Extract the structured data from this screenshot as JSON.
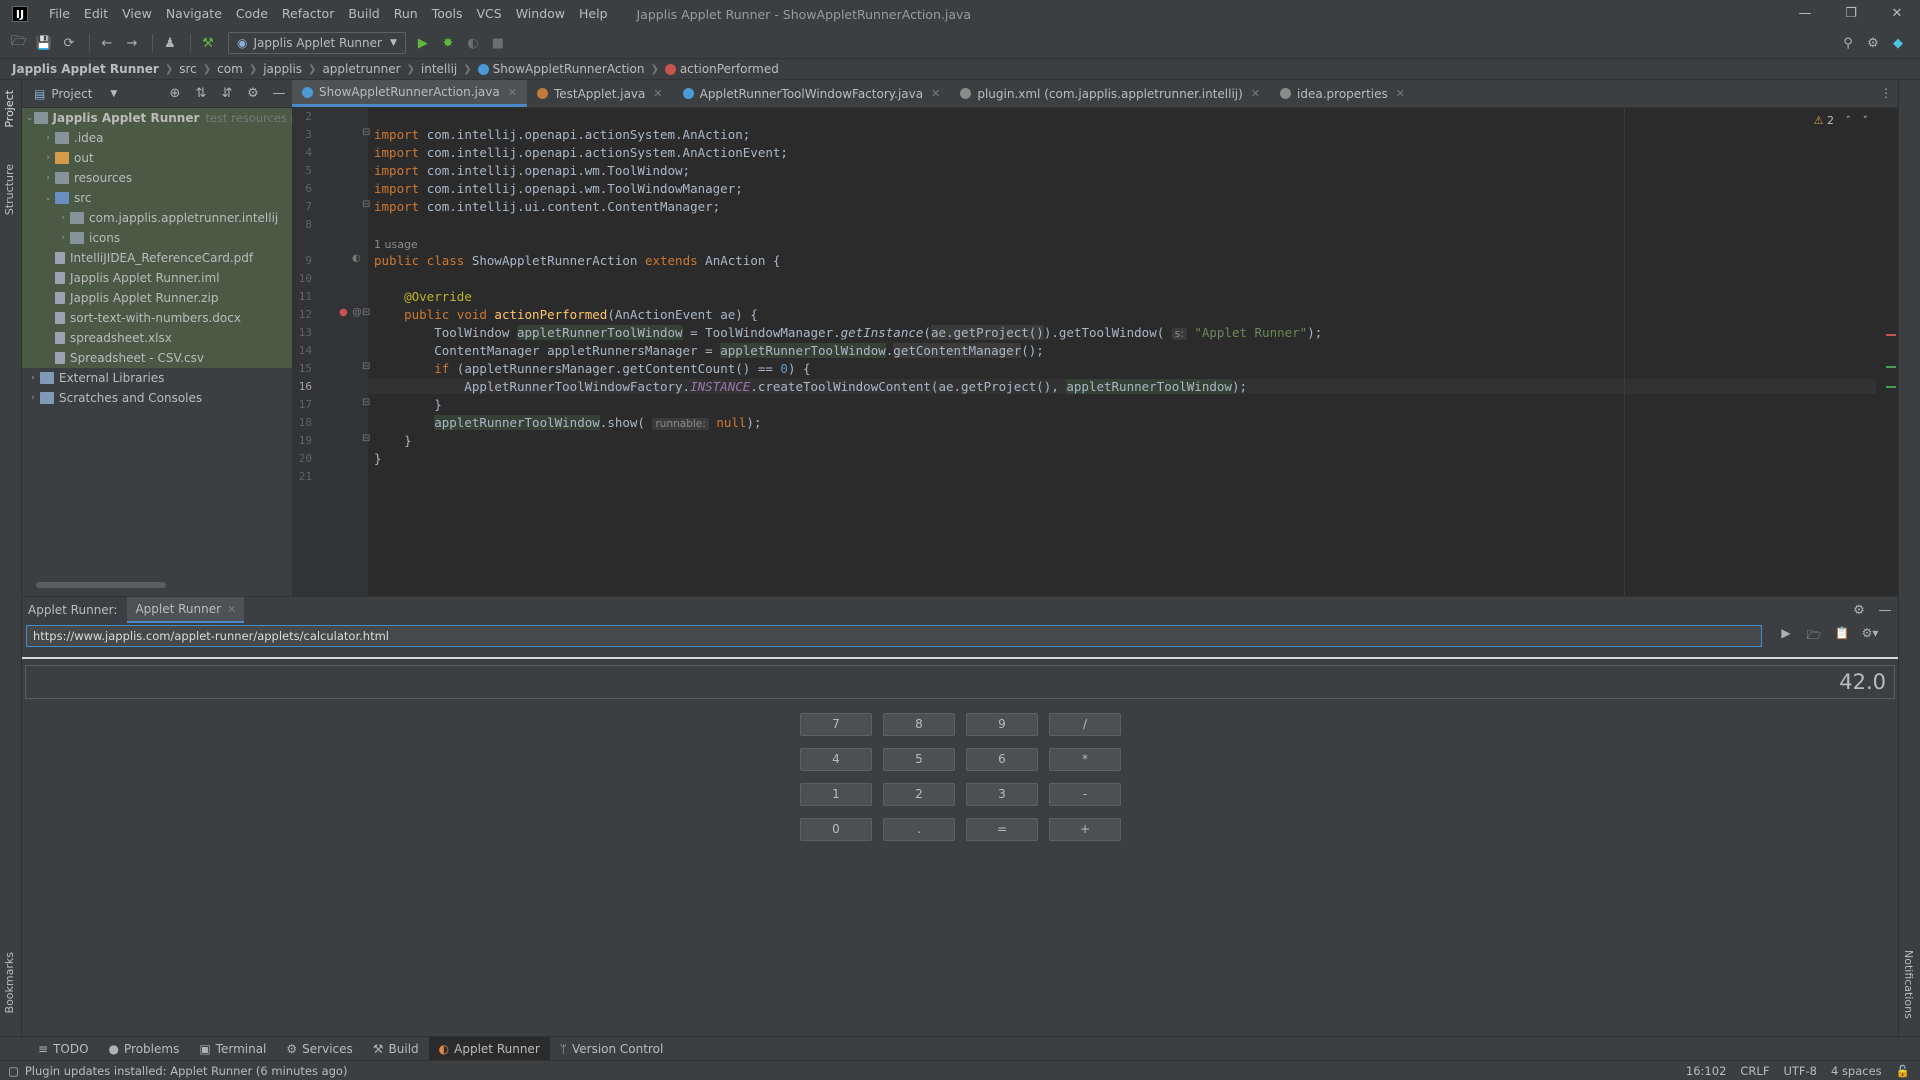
{
  "titlebar": {
    "logo": "IJ",
    "menu": [
      "File",
      "Edit",
      "View",
      "Navigate",
      "Code",
      "Refactor",
      "Build",
      "Run",
      "Tools",
      "VCS",
      "Window",
      "Help"
    ],
    "window_title": "Japplis Applet Runner - ShowAppletRunnerAction.java"
  },
  "toolbar": {
    "run_config": "Japplis Applet Runner"
  },
  "breadcrumb": [
    "Japplis Applet Runner",
    "src",
    "com",
    "japplis",
    "appletrunner",
    "intellij",
    "ShowAppletRunnerAction",
    "actionPerformed"
  ],
  "sidebar": {
    "left_tabs": [
      "Project",
      "Structure",
      "Bookmarks"
    ],
    "right_tabs": [
      "Notifications"
    ]
  },
  "project": {
    "title": "Project",
    "tree": [
      {
        "label": "Japplis Applet Runner",
        "hint": "test resources root,",
        "depth": 0,
        "expanded": true,
        "icon": "folder",
        "bold": true
      },
      {
        "label": ".idea",
        "depth": 1,
        "expanded": false,
        "icon": "folder"
      },
      {
        "label": "out",
        "depth": 1,
        "expanded": false,
        "icon": "folder-orange"
      },
      {
        "label": "resources",
        "depth": 1,
        "expanded": false,
        "icon": "folder"
      },
      {
        "label": "src",
        "depth": 1,
        "expanded": true,
        "icon": "folder-blue"
      },
      {
        "label": "com.japplis.appletrunner.intellij",
        "depth": 2,
        "expanded": false,
        "icon": "package"
      },
      {
        "label": "icons",
        "depth": 2,
        "expanded": false,
        "icon": "package"
      },
      {
        "label": "IntelliJIDEA_ReferenceCard.pdf",
        "depth": 1,
        "icon": "file"
      },
      {
        "label": "Japplis Applet Runner.iml",
        "depth": 1,
        "icon": "file"
      },
      {
        "label": "Japplis Applet Runner.zip",
        "depth": 1,
        "icon": "file"
      },
      {
        "label": "sort-text-with-numbers.docx",
        "depth": 1,
        "icon": "file"
      },
      {
        "label": "spreadsheet.xlsx",
        "depth": 1,
        "icon": "file"
      },
      {
        "label": "Spreadsheet - CSV.csv",
        "depth": 1,
        "icon": "file"
      },
      {
        "label": "External Libraries",
        "depth": 0,
        "expanded": false,
        "icon": "lib"
      },
      {
        "label": "Scratches and Consoles",
        "depth": 0,
        "expanded": false,
        "icon": "lib"
      }
    ]
  },
  "editor": {
    "tabs": [
      {
        "label": "ShowAppletRunnerAction.java",
        "active": true,
        "color": "#4a9ad6"
      },
      {
        "label": "TestApplet.java",
        "active": false,
        "color": "#c07a3a"
      },
      {
        "label": "AppletRunnerToolWindowFactory.java",
        "active": false,
        "color": "#4a9ad6"
      },
      {
        "label": "plugin.xml (com.japplis.appletrunner.intellij)",
        "active": false,
        "color": "#8a8a8a"
      },
      {
        "label": "idea.properties",
        "active": false,
        "color": "#8a8a8a"
      }
    ],
    "warnings": "2",
    "usage_hint": "1 usage",
    "hint_s": "s:",
    "hint_runnable": "runnable:",
    "line_numbers": [
      "2",
      "3",
      "4",
      "5",
      "6",
      "7",
      "8",
      "9",
      "10",
      "11",
      "12",
      "13",
      "14",
      "15",
      "16",
      "17",
      "18",
      "19",
      "20",
      "21"
    ],
    "current_line": "16",
    "code": {
      "imp1": "com.intellij.openapi.actionSystem.AnAction;",
      "imp2": "com.intellij.openapi.actionSystem.AnActionEvent;",
      "imp3": "com.intellij.openapi.wm.ToolWindow;",
      "imp4": "com.intellij.openapi.wm.ToolWindowManager;",
      "imp5": "com.intellij.ui.content.ContentManager;",
      "class_name": "ShowAppletRunnerAction",
      "super_name": "AnAction",
      "annotation": "@Override",
      "method": "actionPerformed",
      "param": "(AnActionEvent ae) {",
      "applet_name": "\"Applet Runner\""
    }
  },
  "tool_window": {
    "title": "Applet Runner:",
    "tab": "Applet Runner",
    "url": "https://www.japplis.com/applet-runner/applets/calculator.html",
    "display": "42.0",
    "keys": [
      "7",
      "8",
      "9",
      "/",
      "4",
      "5",
      "6",
      "*",
      "1",
      "2",
      "3",
      "-",
      "0",
      ".",
      "=",
      "+"
    ]
  },
  "bottom_tabs": [
    {
      "label": "TODO",
      "icon": "≡"
    },
    {
      "label": "Problems",
      "icon": "●"
    },
    {
      "label": "Terminal",
      "icon": "▣"
    },
    {
      "label": "Services",
      "icon": "⚙"
    },
    {
      "label": "Build",
      "icon": "⚒"
    },
    {
      "label": "Applet Runner",
      "icon": "◐",
      "active": true
    },
    {
      "label": "Version Control",
      "icon": "ᛘ"
    }
  ],
  "statusbar": {
    "message": "Plugin updates installed: Applet Runner (6 minutes ago)",
    "position": "16:102",
    "line_sep": "CRLF",
    "encoding": "UTF-8",
    "indent": "4 spaces"
  }
}
